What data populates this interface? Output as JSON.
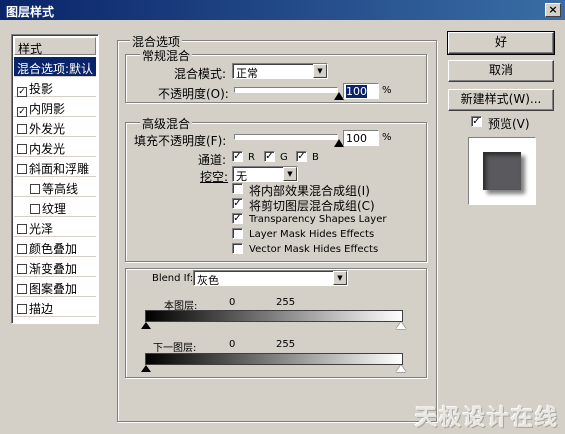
{
  "window": {
    "title": "图层样式",
    "close": "×"
  },
  "styles": {
    "header": "样式",
    "items": [
      {
        "label": "混合选项:默认",
        "checkbox": false,
        "checked": false,
        "selected": true,
        "sub": false
      },
      {
        "label": "投影",
        "checkbox": true,
        "checked": true,
        "selected": false,
        "sub": false
      },
      {
        "label": "内阴影",
        "checkbox": true,
        "checked": true,
        "selected": false,
        "sub": false
      },
      {
        "label": "外发光",
        "checkbox": true,
        "checked": false,
        "selected": false,
        "sub": false
      },
      {
        "label": "内发光",
        "checkbox": true,
        "checked": false,
        "selected": false,
        "sub": false
      },
      {
        "label": "斜面和浮雕",
        "checkbox": true,
        "checked": false,
        "selected": false,
        "sub": false
      },
      {
        "label": "等高线",
        "checkbox": true,
        "checked": false,
        "selected": false,
        "sub": true
      },
      {
        "label": "纹理",
        "checkbox": true,
        "checked": false,
        "selected": false,
        "sub": true
      },
      {
        "label": "光泽",
        "checkbox": true,
        "checked": false,
        "selected": false,
        "sub": false
      },
      {
        "label": "颜色叠加",
        "checkbox": true,
        "checked": false,
        "selected": false,
        "sub": false
      },
      {
        "label": "渐变叠加",
        "checkbox": true,
        "checked": false,
        "selected": false,
        "sub": false
      },
      {
        "label": "图案叠加",
        "checkbox": true,
        "checked": false,
        "selected": false,
        "sub": false
      },
      {
        "label": "描边",
        "checkbox": true,
        "checked": false,
        "selected": false,
        "sub": false
      }
    ]
  },
  "blending": {
    "title": "混合选项",
    "general": {
      "title": "常规混合",
      "mode_label": "混合模式:",
      "mode_value": "正常",
      "opacity_label": "不透明度(O):",
      "opacity_value": "100",
      "opacity_unit": "%"
    },
    "advanced": {
      "title": "高级混合",
      "fill_label": "填充不透明度(F):",
      "fill_value": "100",
      "fill_unit": "%",
      "channels_label": "通道:",
      "channel_r": "R",
      "channel_g": "G",
      "channel_b": "B",
      "knockout_label": "挖空:",
      "knockout_value": "无",
      "options": [
        {
          "label": "将内部效果混合成组(I)",
          "checked": false
        },
        {
          "label": "将剪切图层混合成组(C)",
          "checked": true
        },
        {
          "label": "Transparency Shapes Layer",
          "checked": true
        },
        {
          "label": "Layer Mask Hides Effects",
          "checked": false
        },
        {
          "label": "Vector Mask Hides Effects",
          "checked": false
        }
      ]
    },
    "blendif": {
      "label": "Blend If:",
      "value": "灰色",
      "this_layer": {
        "label": "本图层:",
        "min": "0",
        "max": "255"
      },
      "underlying": {
        "label": "下一图层:",
        "min": "0",
        "max": "255"
      }
    }
  },
  "buttons": {
    "ok": "好",
    "cancel": "取消",
    "new_style": "新建样式(W)...",
    "preview": "预览(V)",
    "preview_checked": true
  },
  "watermark": "天极设计在线"
}
